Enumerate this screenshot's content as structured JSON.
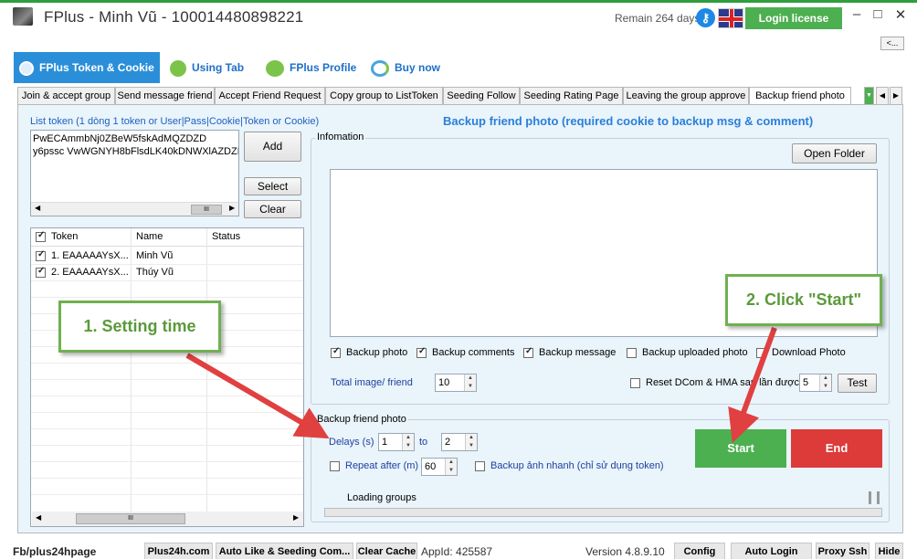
{
  "title_bar": {
    "title": "FPlus - Minh Vũ - 100014480898221",
    "remain": "Remain 264 days",
    "login_label": "Login license",
    "minimize": "–",
    "maximize": "□",
    "close": "✕",
    "collapse": "<..."
  },
  "top_tabs": [
    {
      "label": "FPlus Token & Cookie",
      "icon": "user-icon"
    },
    {
      "label": "Using Tab",
      "icon": "link-icon"
    },
    {
      "label": "FPlus Profile",
      "icon": "group-icon"
    },
    {
      "label": "Buy now",
      "icon": "refresh-icon"
    }
  ],
  "sub_tabs": [
    "Join & accept group",
    "Send message friend",
    "Accept Friend Request",
    "Copy group to ListToken",
    "Seeding Follow",
    "Seeding Rating Page",
    "Leaving the group approve",
    "Backup friend photo"
  ],
  "left": {
    "list_label": "List token (1 dòng 1 token or User|Pass|Cookie|Token or Cookie)",
    "token_text": "PwECAmmbNj0ZBeW5fskAdMQZDZD\ny6pssc VwWGNYH8bFlsdLK40kDNWXlAZDZD",
    "add_label": "Add",
    "select_label": "Select",
    "clear_label": "Clear",
    "columns": [
      "Token",
      "Name",
      "Status"
    ],
    "rows": [
      {
        "token": "1. EAAAAAYsX...",
        "name": "Minh Vũ",
        "status": ""
      },
      {
        "token": "2. EAAAAAYsX...",
        "name": "Thúy Vũ",
        "status": ""
      }
    ]
  },
  "right": {
    "heading": "Backup friend photo (required cookie to backup msg & comment)",
    "info_label": "Infomation",
    "open_folder": "Open Folder",
    "options": {
      "backup_photo": "Backup photo",
      "backup_comments": "Backup comments",
      "backup_message": "Backup message",
      "backup_uploaded": "Backup uploaded photo",
      "download_photo": "Download Photo"
    },
    "total_label": "Total image/ friend",
    "total_value": "10",
    "reset_label": "Reset DCom & HMA sau lần được",
    "reset_value": "5",
    "test_label": "Test",
    "group_title": "Backup friend photo",
    "delays_label": "Delays (s)",
    "delay_from": "1",
    "to_label": "to",
    "delay_to": "2",
    "repeat_label": "Repeat after (m)",
    "repeat_value": "60",
    "fast_label": "Backup ảnh nhanh (chỉ sử dụng token)",
    "loading_label": "Loading groups",
    "start_label": "Start",
    "end_label": "End"
  },
  "callouts": {
    "one": "1. Setting time",
    "two": "2. Click \"Start\""
  },
  "status_bar": {
    "fb": "Fb/plus24hpage",
    "plus24h": "Plus24h.com",
    "auto_like": "Auto Like & Seeding Com...",
    "clear_cache": "Clear Cache",
    "appid": "AppId: 425587",
    "version": "Version 4.8.9.10",
    "config": "Config",
    "auto_login": "Auto Login",
    "proxy": "Proxy Ssh",
    "hide": "Hide"
  },
  "colors": {
    "accent": "#2a8fd8",
    "green": "#4caf50",
    "red": "#dd3a3a",
    "panel": "#e9f4fb"
  }
}
